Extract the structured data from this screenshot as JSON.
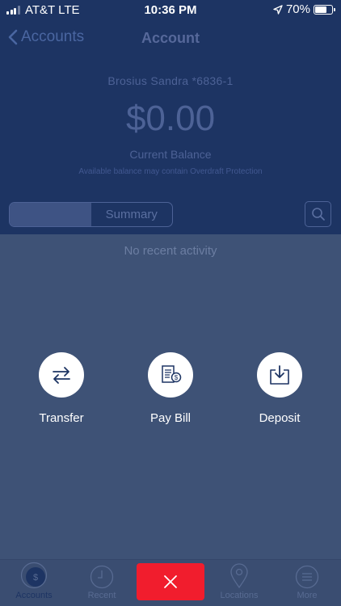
{
  "status_bar": {
    "carrier": "AT&T LTE",
    "time": "10:36 PM",
    "battery": "70%",
    "battery_level": 0.7
  },
  "nav": {
    "back_label": "Accounts",
    "title": "Account"
  },
  "account": {
    "name": "Brosius Sandra *6836-1",
    "balance": "$0.00",
    "balance_label": "Current Balance",
    "note": "Available balance may contain Overdraft Protection"
  },
  "segments": {
    "first": "",
    "second": "Summary"
  },
  "activity": {
    "empty": "No recent activity"
  },
  "actions": [
    {
      "label": "Transfer",
      "icon": "transfer-arrows-icon"
    },
    {
      "label": "Pay Bill",
      "icon": "bill-icon"
    },
    {
      "label": "Deposit",
      "icon": "deposit-tray-icon"
    }
  ],
  "tabs": [
    {
      "label": "Accounts",
      "icon": "dollar-coin-icon"
    },
    {
      "label": "Recent",
      "icon": "clock-icon"
    },
    {
      "label": "Locations",
      "icon": "map-pin-icon"
    },
    {
      "label": "More",
      "icon": "menu-lines-icon"
    }
  ],
  "colors": {
    "header_bg": "#1d3463",
    "overlay_bg": "#3e5276",
    "close_button": "#f11d2d",
    "icon_navy": "#1d3463"
  }
}
